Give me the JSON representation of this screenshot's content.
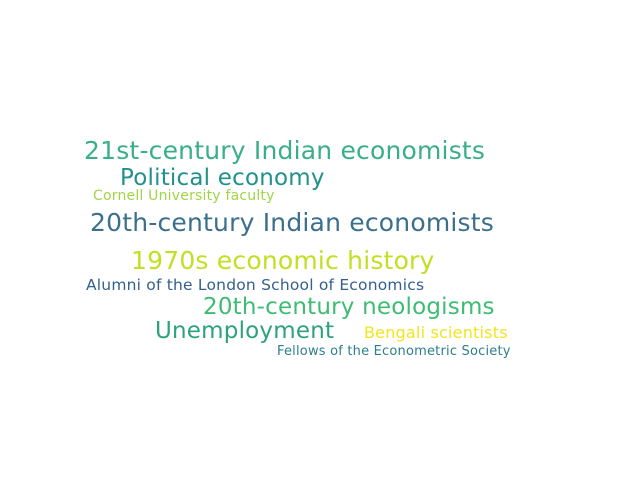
{
  "words": [
    {
      "text": "21st-century Indian economists",
      "color": "#3aaf86"
    },
    {
      "text": "Political economy",
      "color": "#21918c"
    },
    {
      "text": "Cornell University faculty",
      "color": "#a0d545"
    },
    {
      "text": "20th-century Indian economists",
      "color": "#3b6f8e"
    },
    {
      "text": "1970s economic history",
      "color": "#c2df23"
    },
    {
      "text": "Alumni of the London School of Economics",
      "color": "#35608d"
    },
    {
      "text": "20th-century neologisms",
      "color": "#3dbc74"
    },
    {
      "text": "Unemployment",
      "color": "#2ea37a"
    },
    {
      "text": "Bengali scientists",
      "color": "#f2e51d"
    },
    {
      "text": "Fellows of the Econometric Society",
      "color": "#2c7f8e"
    }
  ]
}
